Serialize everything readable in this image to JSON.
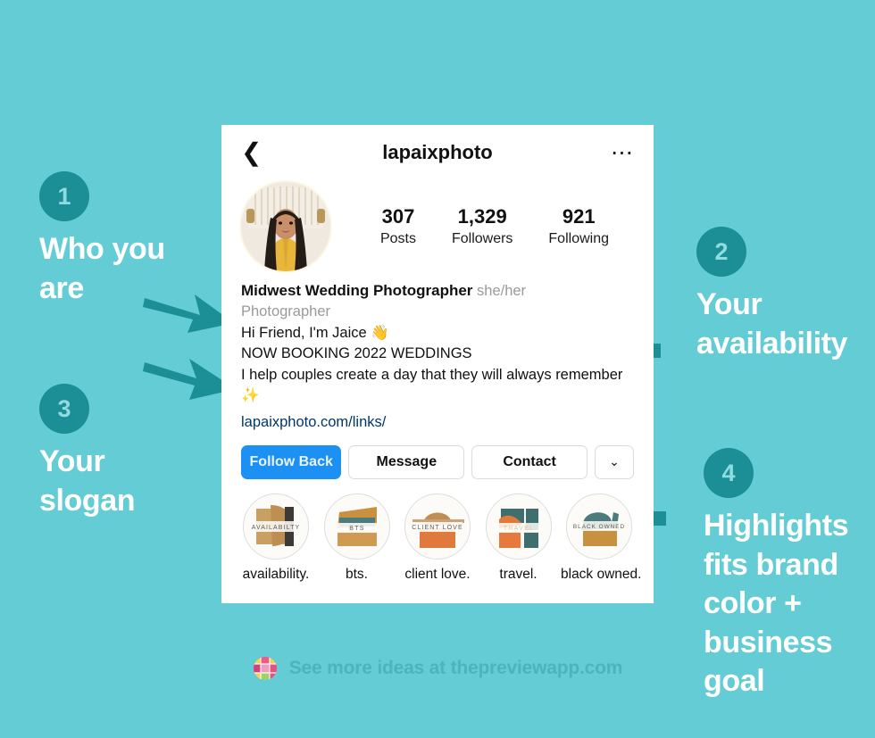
{
  "theme": {
    "background": "#63ccd4",
    "accent_dark": "#1b8e96",
    "annotation_text": "#ffffff",
    "arrow_color": "#1b8e96",
    "instagram_blue": "#1d90f4",
    "link_blue": "#00376b",
    "footer_text": "#4db3bd"
  },
  "annotations": [
    {
      "number": "1",
      "text": "Who you\nare"
    },
    {
      "number": "2",
      "text": "Your\navailability"
    },
    {
      "number": "3",
      "text": "Your\nslogan"
    },
    {
      "number": "4",
      "text": "Highlights\nfits brand\ncolor +\nbusiness\ngoal"
    }
  ],
  "profile": {
    "header": {
      "back_icon": "chevron-left-icon",
      "username": "lapaixphoto",
      "more_icon": "ellipsis-icon"
    },
    "stats": [
      {
        "value": "307",
        "label": "Posts"
      },
      {
        "value": "1,329",
        "label": "Followers"
      },
      {
        "value": "921",
        "label": "Following"
      }
    ],
    "bio": {
      "display_name": "Midwest Wedding Photographer",
      "pronouns": "she/her",
      "category": "Photographer",
      "lines": [
        "Hi Friend, I'm Jaice 👋",
        "NOW BOOKING 2022 WEDDINGS",
        "I help couples create a day that they will always remember ✨"
      ],
      "link": "lapaixphoto.com/links/"
    },
    "actions": [
      {
        "label": "Follow Back",
        "style": "primary"
      },
      {
        "label": "Message",
        "style": "secondary"
      },
      {
        "label": "Contact",
        "style": "secondary"
      },
      {
        "label": "⌄",
        "style": "chevron"
      }
    ],
    "highlights": [
      {
        "label": "availability.",
        "cover_text": "AVAILABILTY"
      },
      {
        "label": "bts.",
        "cover_text": "BTS"
      },
      {
        "label": "client love.",
        "cover_text": "CLIENT LOVE"
      },
      {
        "label": "travel.",
        "cover_text": "TRAVEL"
      },
      {
        "label": "black owned.",
        "cover_text": "BLACK OWNED"
      }
    ]
  },
  "footer": {
    "logo_icon": "preview-app-logo-icon",
    "text": "See more ideas at thepreviewapp.com"
  }
}
